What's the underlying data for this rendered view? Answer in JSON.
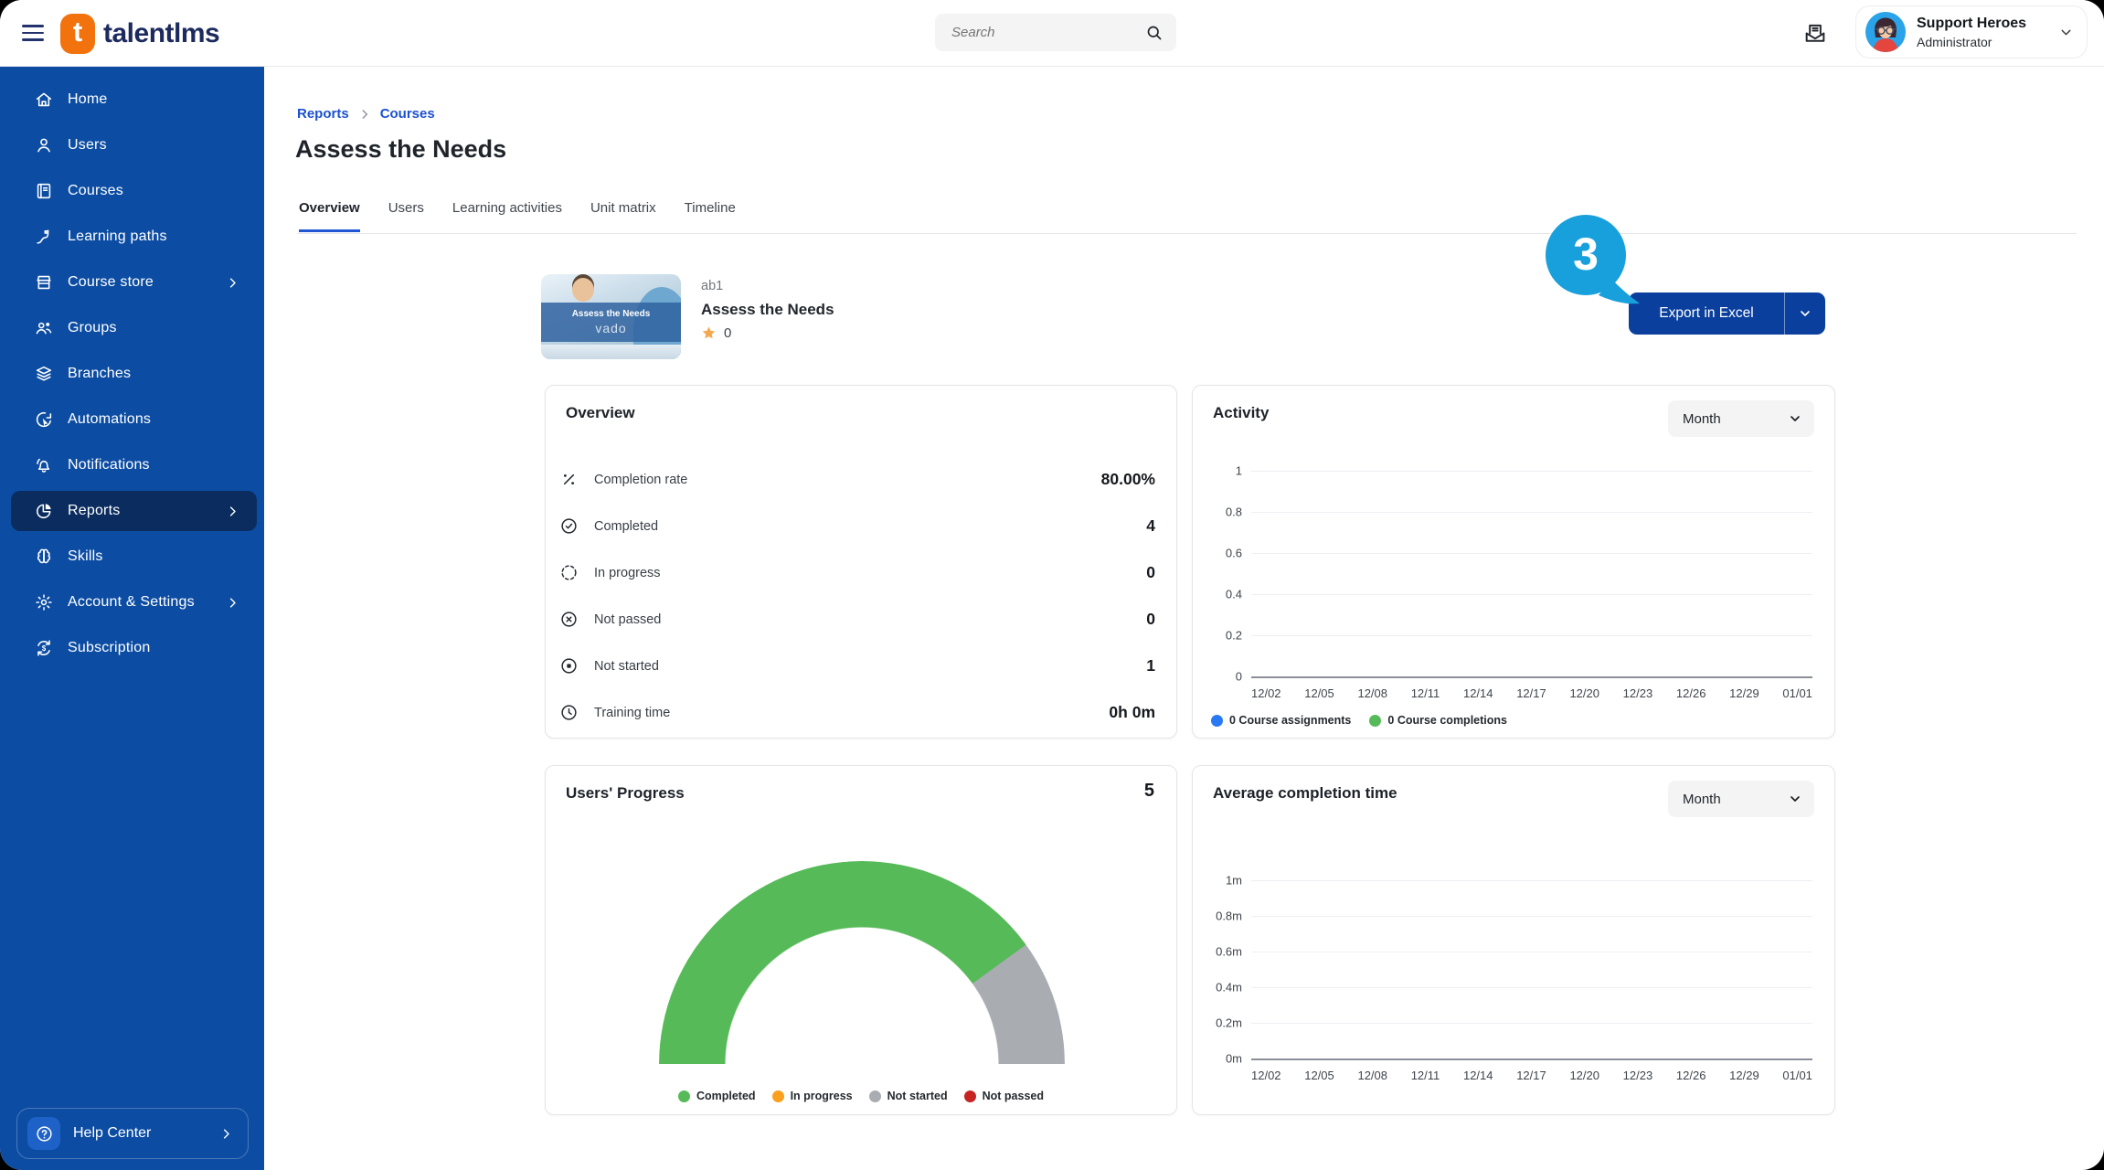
{
  "topbar": {
    "logo_text": "talentlms",
    "search_placeholder": "Search",
    "user": {
      "name": "Support Heroes",
      "role": "Administrator"
    }
  },
  "sidebar": {
    "items": [
      {
        "label": "Home",
        "icon": "home"
      },
      {
        "label": "Users",
        "icon": "user"
      },
      {
        "label": "Courses",
        "icon": "book"
      },
      {
        "label": "Learning paths",
        "icon": "path-flag"
      },
      {
        "label": "Course store",
        "icon": "storefront",
        "chevron": true
      },
      {
        "label": "Groups",
        "icon": "people"
      },
      {
        "label": "Branches",
        "icon": "layers"
      },
      {
        "label": "Automations",
        "icon": "automation"
      },
      {
        "label": "Notifications",
        "icon": "bell"
      },
      {
        "label": "Reports",
        "icon": "pie-chart",
        "chevron": true,
        "selected": true
      },
      {
        "label": "Skills",
        "icon": "brain"
      },
      {
        "label": "Account & Settings",
        "icon": "gear",
        "chevron": true
      },
      {
        "label": "Subscription",
        "icon": "renew-dollar"
      }
    ],
    "help": {
      "label": "Help Center",
      "icon": "question-circle"
    }
  },
  "page": {
    "breadcrumb": [
      "Reports",
      "Courses"
    ],
    "title": "Assess the Needs",
    "tabs": [
      {
        "label": "Overview",
        "active": true
      },
      {
        "label": "Users",
        "active": false
      },
      {
        "label": "Learning activities",
        "active": false
      },
      {
        "label": "Unit matrix",
        "active": false
      },
      {
        "label": "Timeline",
        "active": false
      }
    ]
  },
  "course": {
    "code": "ab1",
    "name": "Assess the Needs",
    "rating": "0",
    "thumb": {
      "title": "Assess the Needs",
      "brand": "vado"
    }
  },
  "annotation": {
    "label": "3",
    "color": "#18A0DC"
  },
  "toolbar": {
    "export_label": "Export in Excel"
  },
  "overview_card": {
    "title": "Overview",
    "rows": [
      {
        "icon": "percent",
        "label": "Completion rate",
        "value": "80.00%"
      },
      {
        "icon": "check-circle",
        "label": "Completed",
        "value": "4"
      },
      {
        "icon": "progress-circle",
        "label": "In progress",
        "value": "0"
      },
      {
        "icon": "x-circle",
        "label": "Not passed",
        "value": "0"
      },
      {
        "icon": "dot-circle",
        "label": "Not started",
        "value": "1"
      },
      {
        "icon": "clock",
        "label": "Training time",
        "value": "0h 0m"
      }
    ]
  },
  "chart_data": [
    {
      "id": "activity",
      "type": "line",
      "title": "Activity",
      "period": "Month",
      "ylim": [
        0,
        1
      ],
      "yticks": [
        "1",
        "0.8",
        "0.6",
        "0.4",
        "0.2",
        "0"
      ],
      "grid": true,
      "x": [
        "12/02",
        "12/05",
        "12/08",
        "12/11",
        "12/14",
        "12/17",
        "12/20",
        "12/23",
        "12/26",
        "12/29",
        "01/01"
      ],
      "series": [
        {
          "name": "0 Course assignments",
          "color": "#2979F2",
          "values": [
            0,
            0,
            0,
            0,
            0,
            0,
            0,
            0,
            0,
            0,
            0
          ]
        },
        {
          "name": "0 Course completions",
          "color": "#56BA5A",
          "values": [
            0,
            0,
            0,
            0,
            0,
            0,
            0,
            0,
            0,
            0,
            0
          ]
        }
      ],
      "legend_position": "bottom"
    },
    {
      "id": "users_progress",
      "type": "gauge",
      "title": "Users' Progress",
      "total": "5",
      "segments": [
        {
          "label": "Completed",
          "value": 4,
          "color": "#57BA59"
        },
        {
          "label": "In progress",
          "value": 0,
          "color": "#F9A01E"
        },
        {
          "label": "Not started",
          "value": 1,
          "color": "#A9ADB2"
        },
        {
          "label": "Not passed",
          "value": 0,
          "color": "#C62323"
        }
      ]
    },
    {
      "id": "avg_completion",
      "type": "line",
      "title": "Average completion time",
      "period": "Month",
      "yticks": [
        "1m",
        "0.8m",
        "0.6m",
        "0.4m",
        "0.2m",
        "0m"
      ],
      "grid": true,
      "x": [
        "12/02",
        "12/05",
        "12/08",
        "12/11",
        "12/14",
        "12/17",
        "12/20",
        "12/23",
        "12/26",
        "12/29",
        "01/01"
      ],
      "series": [],
      "legend_position": "none"
    }
  ]
}
